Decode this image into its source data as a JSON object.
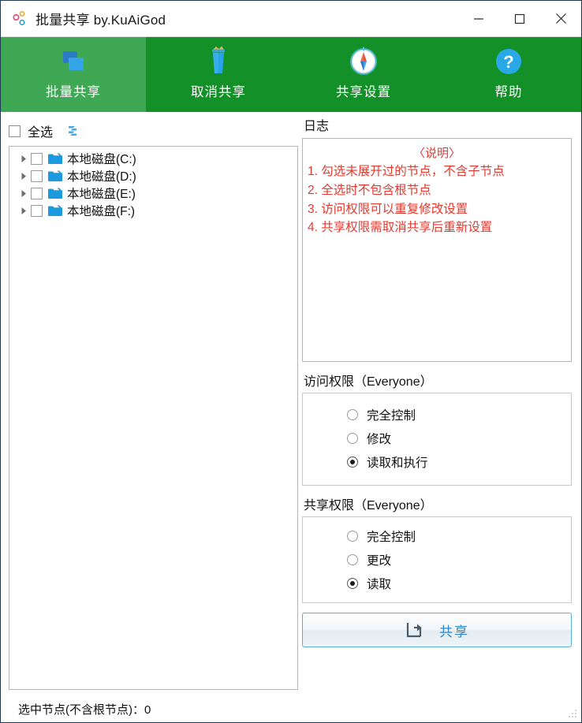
{
  "window": {
    "title": "批量共享 by.KuAiGod",
    "app_icon": "app-dots-icon",
    "controls": [
      {
        "name": "minimize",
        "glyph": "—"
      },
      {
        "name": "maximize",
        "glyph": "❐"
      },
      {
        "name": "close",
        "glyph": "✕"
      }
    ]
  },
  "toolbar": {
    "tabs": [
      {
        "label": "批量共享",
        "icon": "batch-share-icon",
        "active": true
      },
      {
        "label": "取消共享",
        "icon": "trash-bin-icon",
        "active": false
      },
      {
        "label": "共享设置",
        "icon": "compass-icon",
        "active": false
      },
      {
        "label": "帮助",
        "icon": "question-mark-icon",
        "active": false
      }
    ],
    "active_color": "#3FA854",
    "inactive_color": "#149029"
  },
  "left": {
    "select_all_label": "全选",
    "select_all_checked": false,
    "refresh_icon": "refresh-icon",
    "tree_items": [
      {
        "label": "本地磁盘(C:)",
        "checked": false,
        "expanded": false
      },
      {
        "label": "本地磁盘(D:)",
        "checked": false,
        "expanded": false
      },
      {
        "label": "本地磁盘(E:)",
        "checked": false,
        "expanded": false
      },
      {
        "label": "本地磁盘(F:)",
        "checked": false,
        "expanded": false
      }
    ]
  },
  "status": {
    "text": "选中节点(不含根节点)：0"
  },
  "log": {
    "caption": "日志",
    "heading": "〈说明〉",
    "lines": [
      "1. 勾选未展开过的节点，不含子节点",
      "2. 全选时不包含根节点",
      "3. 访问权限可以重复修改设置",
      "4. 共享权限需取消共享后重新设置"
    ],
    "text_color": "#E2392F"
  },
  "access_permission": {
    "caption": "访问权限（Everyone）",
    "options": [
      {
        "label": "完全控制",
        "selected": false
      },
      {
        "label": "修改",
        "selected": false
      },
      {
        "label": "读取和执行",
        "selected": true
      }
    ]
  },
  "share_permission": {
    "caption": "共享权限（Everyone）",
    "options": [
      {
        "label": "完全控制",
        "selected": false
      },
      {
        "label": "更改",
        "selected": false
      },
      {
        "label": "读取",
        "selected": true
      }
    ]
  },
  "share_button": {
    "label": "共享",
    "icon": "share-arrow-icon",
    "accent_color": "#2E86C8"
  }
}
